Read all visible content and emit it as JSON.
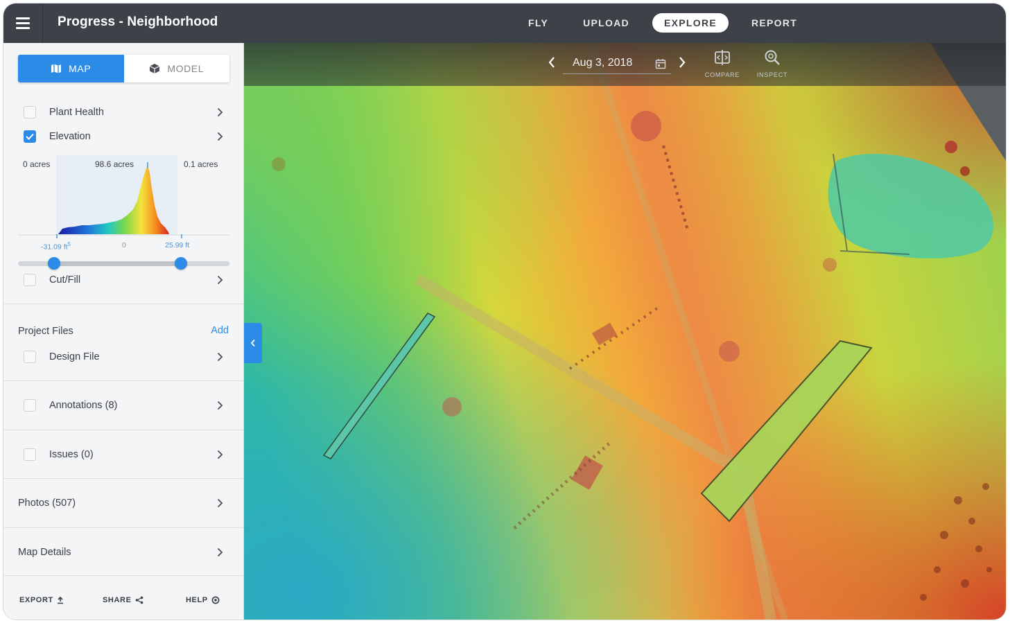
{
  "header": {
    "title": "Progress - Neighborhood",
    "nav": [
      {
        "label": "FLY",
        "active": false
      },
      {
        "label": "UPLOAD",
        "active": false
      },
      {
        "label": "EXPLORE",
        "active": true
      },
      {
        "label": "REPORT",
        "active": false
      }
    ]
  },
  "sidebar": {
    "view_toggle": {
      "map": "MAP",
      "model": "MODEL"
    },
    "layers": [
      {
        "label": "Plant Health",
        "checked": false
      },
      {
        "label": "Elevation",
        "checked": true
      }
    ],
    "histogram": {
      "left": "0 acres",
      "center": "98.6 acres",
      "right": "0.1 acres",
      "min_label": "-31.09 ft",
      "min_label_sup": "5",
      "zero_label": "0",
      "max_label": "25.99 ft",
      "range_low": 0.17,
      "range_high": 0.77
    },
    "cutfill": {
      "label": "Cut/Fill",
      "checked": false
    },
    "project_files": {
      "title": "Project Files",
      "add": "Add",
      "design_file": "Design File"
    },
    "annotations": "Annotations (8)",
    "issues": "Issues (0)",
    "photos": "Photos (507)",
    "map_details": "Map Details",
    "footer": {
      "export": "EXPORT",
      "share": "SHARE",
      "help": "HELP"
    }
  },
  "map": {
    "date": "Aug 3, 2018",
    "tools": [
      {
        "label": "COMPARE",
        "icon": "compare-icon"
      },
      {
        "label": "INSPECT",
        "icon": "inspect-icon"
      }
    ]
  },
  "colors": {
    "accent": "#2c8be6",
    "topbar": "#3d4248",
    "sidebar": "#f4f5f6"
  }
}
